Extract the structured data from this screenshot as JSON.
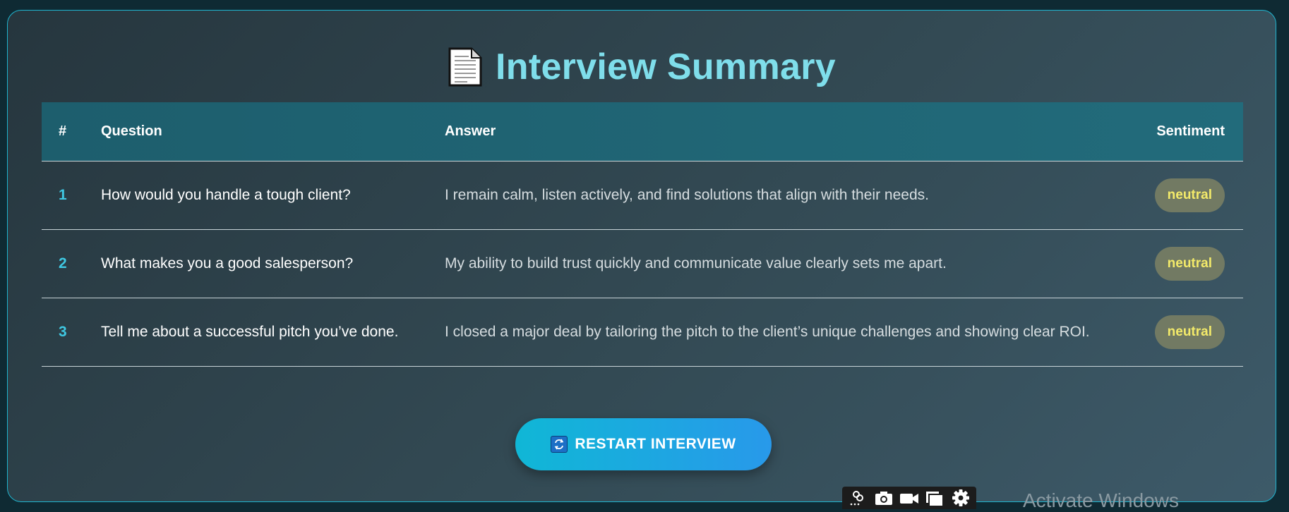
{
  "header": {
    "icon": "document-icon",
    "title": "Interview Summary"
  },
  "table": {
    "columns": [
      "#",
      "Question",
      "Answer",
      "Sentiment"
    ],
    "rows": [
      {
        "num": "1",
        "question": "How would you handle a tough client?",
        "answer": "I remain calm, listen actively, and find solutions that align with their needs.",
        "sentiment": "neutral"
      },
      {
        "num": "2",
        "question": "What makes you a good salesperson?",
        "answer": "My ability to build trust quickly and communicate value clearly sets me apart.",
        "sentiment": "neutral"
      },
      {
        "num": "3",
        "question": "Tell me about a successful pitch you’ve done.",
        "answer": "I closed a major deal by tailoring the pitch to the client’s unique challenges and showing clear ROI.",
        "sentiment": "neutral"
      }
    ]
  },
  "restart_button": {
    "icon": "repeat-icon",
    "label": "RESTART INTERVIEW"
  },
  "toolbar": {
    "icons": [
      "link-icon",
      "camera-icon",
      "video-camera-icon",
      "copy-icon",
      "gear-icon"
    ]
  },
  "watermark": "Activate Windows",
  "colors": {
    "accent": "#7fdeeb",
    "header_bg": "#1f6475",
    "badge_bg": "#727a63",
    "badge_text": "#f3ea6a",
    "button_start": "#10b7d6",
    "button_end": "#2899ea"
  }
}
